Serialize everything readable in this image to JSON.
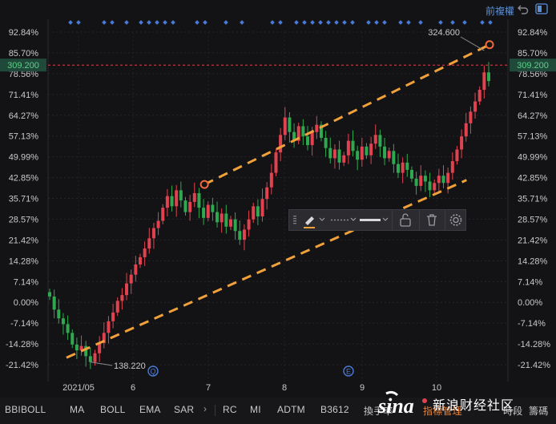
{
  "header": {
    "title": "前複權"
  },
  "chart_data": {
    "type": "candlestick",
    "y_ticks_pct": [
      "92.84%",
      "85.70%",
      "78.56%",
      "71.41%",
      "64.27%",
      "57.13%",
      "49.99%",
      "42.85%",
      "35.71%",
      "28.57%",
      "21.42%",
      "14.28%",
      "7.14%",
      "0.00%",
      "-7.14%",
      "-14.28%",
      "-21.42%"
    ],
    "y_tick_values": [
      92.84,
      85.7,
      78.56,
      71.41,
      64.27,
      57.13,
      49.99,
      42.85,
      35.71,
      28.57,
      21.42,
      14.28,
      7.14,
      0.0,
      -7.14,
      -14.28,
      -21.42
    ],
    "x_ticks": [
      "2021/05",
      "6",
      "7",
      "8",
      "9",
      "10"
    ],
    "current_price": "309.200",
    "high_label": "324.600",
    "low_label": "138.220",
    "event_markers": [
      "Q",
      "E"
    ],
    "closes": [
      2.0,
      -2.5,
      -5.5,
      -7.5,
      -10.5,
      -14.5,
      -16.5,
      -15.0,
      -18.5,
      -20.5,
      -17.5,
      -14.0,
      -10.5,
      -6.5,
      -3.5,
      0.5,
      2.5,
      6.5,
      9.5,
      13.0,
      15.5,
      18.5,
      22.0,
      25.5,
      28.0,
      32.5,
      36.5,
      33.0,
      38.5,
      35.0,
      31.0,
      34.5,
      37.5,
      32.5,
      29.0,
      33.5,
      31.0,
      27.5,
      30.5,
      26.0,
      28.5,
      24.5,
      21.5,
      25.0,
      28.5,
      33.0,
      29.5,
      35.5,
      39.5,
      44.5,
      51.5,
      57.5,
      63.5,
      58.5,
      55.5,
      60.5,
      57.0,
      54.0,
      58.5,
      61.0,
      56.5,
      53.0,
      49.5,
      52.5,
      48.0,
      50.5,
      55.5,
      52.0,
      49.0,
      53.5,
      50.5,
      54.5,
      57.5,
      53.5,
      49.5,
      52.0,
      47.5,
      44.5,
      48.0,
      45.5,
      42.5,
      40.0,
      43.5,
      41.5,
      38.5,
      41.0,
      43.5,
      41.0,
      44.5,
      48.5,
      52.5,
      57.0,
      61.5,
      65.5,
      69.0,
      73.0,
      79.0,
      76.0
    ],
    "upper_channel_pct": [
      [
        34,
        40.5
      ],
      [
        96,
        88.5
      ]
    ],
    "lower_channel_pct": [
      [
        4,
        -19.0
      ],
      [
        91,
        42.0
      ]
    ],
    "drawing_toolbar_icons": [
      "pen-icon",
      "dotted-line-icon",
      "solid-line-icon",
      "lock-icon",
      "trash-icon",
      "gear-icon"
    ],
    "colors": {
      "up": "#e0434f",
      "down": "#2fa84f",
      "channel": "#f0a13a",
      "price_line": "#e0434f",
      "marker": "#4a7ad6"
    }
  },
  "bottom": {
    "indicators": [
      "BBIBOLL",
      "MA",
      "BOLL",
      "EMA",
      "SAR",
      "RC",
      "MI",
      "ADTM",
      "B3612",
      "換手率",
      "指標管理",
      "時段",
      "籌碼"
    ],
    "active": "指標管理",
    "watermark_cn": "新浪财经社区"
  }
}
